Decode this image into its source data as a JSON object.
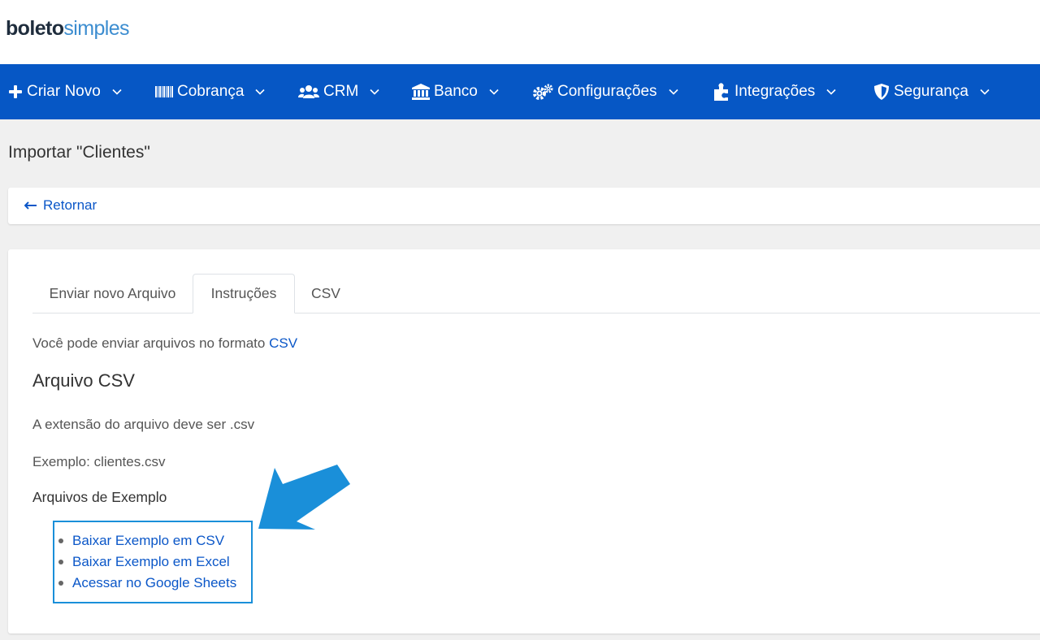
{
  "brand": {
    "logo_bold": "boleto",
    "logo_light": "simples"
  },
  "nav": {
    "items": [
      {
        "label": "Criar Novo",
        "icon": "plus-icon"
      },
      {
        "label": "Cobrança",
        "icon": "barcode-icon"
      },
      {
        "label": "CRM",
        "icon": "users-icon"
      },
      {
        "label": "Banco",
        "icon": "bank-icon"
      },
      {
        "label": "Configurações",
        "icon": "cogs-icon"
      },
      {
        "label": "Integrações",
        "icon": "puzzle-icon"
      },
      {
        "label": "Segurança",
        "icon": "shield-icon"
      }
    ]
  },
  "page": {
    "title": "Importar \"Clientes\"",
    "back_label": "Retornar"
  },
  "tabs": [
    {
      "label": "Enviar novo Arquivo",
      "active": false
    },
    {
      "label": "Instruções",
      "active": true
    },
    {
      "label": "CSV",
      "active": false
    }
  ],
  "instructions": {
    "intro_text": "Você pode enviar arquivos no formato",
    "intro_link": "CSV",
    "csv_heading": "Arquivo CSV",
    "extension_text": "A extensão do arquivo deve ser .csv",
    "example_text": "Exemplo: clientes.csv",
    "examples_heading": "Arquivos de Exemplo",
    "example_links": [
      "Baixar Exemplo em CSV",
      "Baixar Exemplo em Excel",
      "Acessar no Google Sheets"
    ]
  },
  "colors": {
    "navbar": "#0657c5",
    "link": "#0b57c8",
    "annotation": "#1a8fd9",
    "background": "#f0f0f0"
  }
}
